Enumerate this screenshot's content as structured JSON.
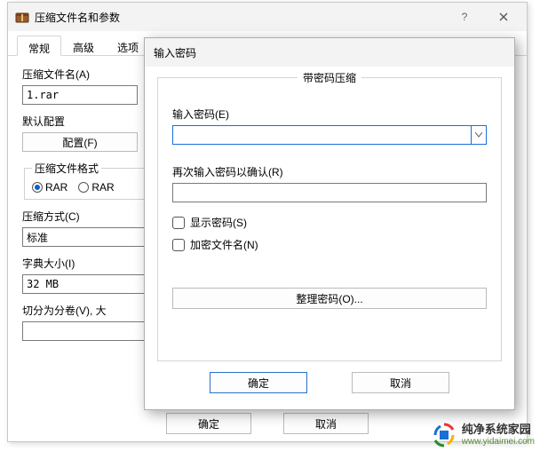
{
  "main": {
    "title": "压缩文件名和参数",
    "tabs": [
      "常规",
      "高级",
      "选项"
    ],
    "archive_name_label": "压缩文件名(A)",
    "archive_name_value": "1.rar",
    "profile_group_label": "默认配置",
    "profile_button": "配置(F)",
    "format_group_label": "压缩文件格式",
    "format_rar": "RAR",
    "format_rar5": "RAR",
    "method_label": "压缩方式(C)",
    "method_value": "标准",
    "dict_label": "字典大小(I)",
    "dict_value": "32 MB",
    "split_label": "切分为分卷(V), 大",
    "ok": "确定",
    "cancel": "取消"
  },
  "pw": {
    "title": "输入密码",
    "frame_title": "带密码压缩",
    "enter_label": "输入密码(E)",
    "enter_value": "",
    "confirm_label": "再次输入密码以确认(R)",
    "confirm_value": "",
    "show_pw": "显示密码(S)",
    "encrypt_names": "加密文件名(N)",
    "organize": "整理密码(O)...",
    "ok": "确定",
    "cancel": "取消"
  },
  "watermark": {
    "name": "纯净系统家园",
    "url": "www.yidaimei.com"
  }
}
